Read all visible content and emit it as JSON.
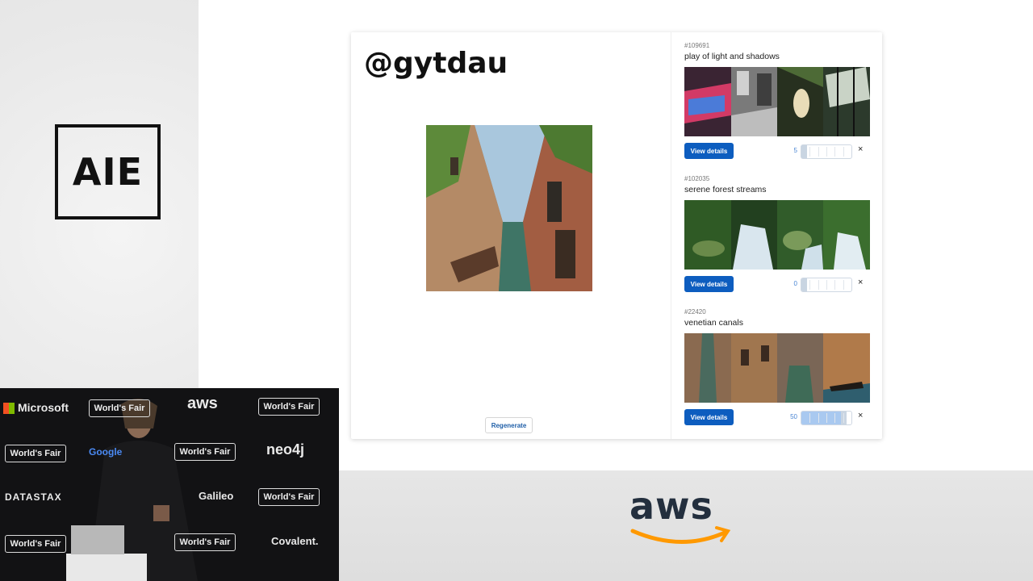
{
  "brand": {
    "logo_text": "AIE",
    "sponsor_text": "aws"
  },
  "app": {
    "handle": "@gytdau",
    "regenerate_label": "Regenerate",
    "topics": [
      {
        "id": "#109691",
        "title": "play of light and shadows",
        "button": "View details",
        "count": "5",
        "level": 0.1
      },
      {
        "id": "#102035",
        "title": "serene forest streams",
        "button": "View details",
        "count": "0",
        "level": 0.0
      },
      {
        "id": "#22420",
        "title": "venetian canals",
        "button": "View details",
        "count": "50",
        "level": 0.9
      }
    ],
    "close_glyph": "×"
  },
  "video": {
    "sponsors": [
      "Microsoft",
      "World's Fair",
      "aws",
      "World's Fair",
      "World's Fair",
      "Google",
      "World's Fair",
      "neo4j",
      "DATASTAX",
      "Galileo",
      "World's Fair",
      "World's Fair",
      "World's Fair",
      "Covalent."
    ]
  },
  "colors": {
    "primary_button": "#0d5dbf",
    "slider_fill": "#a9c9f0",
    "aws_orange": "#ff9900",
    "aws_text": "#232f3e"
  }
}
